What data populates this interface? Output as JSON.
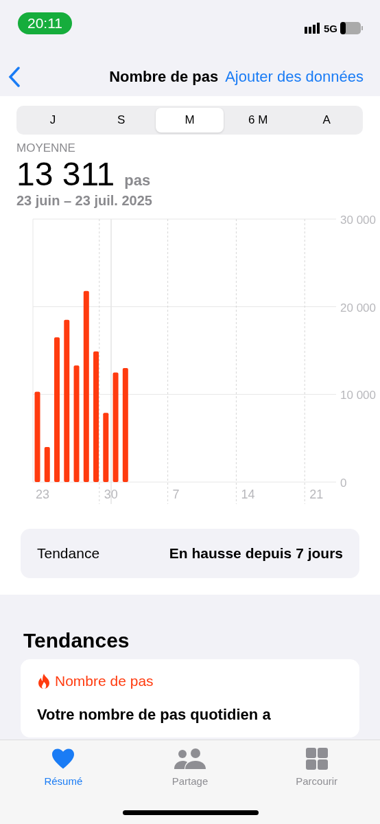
{
  "status_bar": {
    "time": "20:11",
    "network": "5G"
  },
  "nav": {
    "title": "Nombre de pas",
    "action": "Ajouter des données"
  },
  "segments": [
    {
      "label": "J",
      "selected": false
    },
    {
      "label": "S",
      "selected": false
    },
    {
      "label": "M",
      "selected": true
    },
    {
      "label": "6 M",
      "selected": false
    },
    {
      "label": "A",
      "selected": false
    }
  ],
  "summary": {
    "label": "MOYENNE",
    "value": "13 311",
    "unit": "pas",
    "range": "23 juin – 23 juil. 2025"
  },
  "chart_data": {
    "type": "bar",
    "categories": [
      "23",
      null,
      null,
      null,
      null,
      null,
      null,
      "30",
      null,
      null,
      null,
      null,
      null,
      null,
      "7",
      null,
      null,
      null,
      null,
      null,
      null,
      "14",
      null,
      null,
      null,
      null,
      null,
      null,
      "21",
      null,
      null
    ],
    "series": [
      {
        "color": "#ff3b0f",
        "values": [
          10300,
          4000,
          16500,
          18500,
          13300,
          21800,
          14900,
          7900,
          12500,
          13000,
          null,
          null,
          null,
          null,
          null,
          null,
          null,
          null,
          null,
          null,
          null,
          null,
          null,
          null,
          null,
          null,
          null,
          null,
          null,
          null,
          null
        ]
      }
    ],
    "ylim": [
      0,
      30000
    ],
    "grid": true,
    "yticks": [
      {
        "value": 0,
        "label": "0"
      },
      {
        "value": 10000,
        "label": "10 000"
      },
      {
        "value": 20000,
        "label": "20 000"
      },
      {
        "value": 30000,
        "label": "30 000"
      }
    ]
  },
  "trend": {
    "label": "Tendance",
    "value": "En hausse depuis 7 jours"
  },
  "trends_section": {
    "title": "Tendances",
    "card": {
      "category": "Nombre de pas",
      "text": "Votre nombre de pas quotidien a"
    }
  },
  "tab_bar": [
    {
      "label": "Résumé",
      "selected": true
    },
    {
      "label": "Partage",
      "selected": false
    },
    {
      "label": "Parcourir",
      "selected": false
    }
  ]
}
